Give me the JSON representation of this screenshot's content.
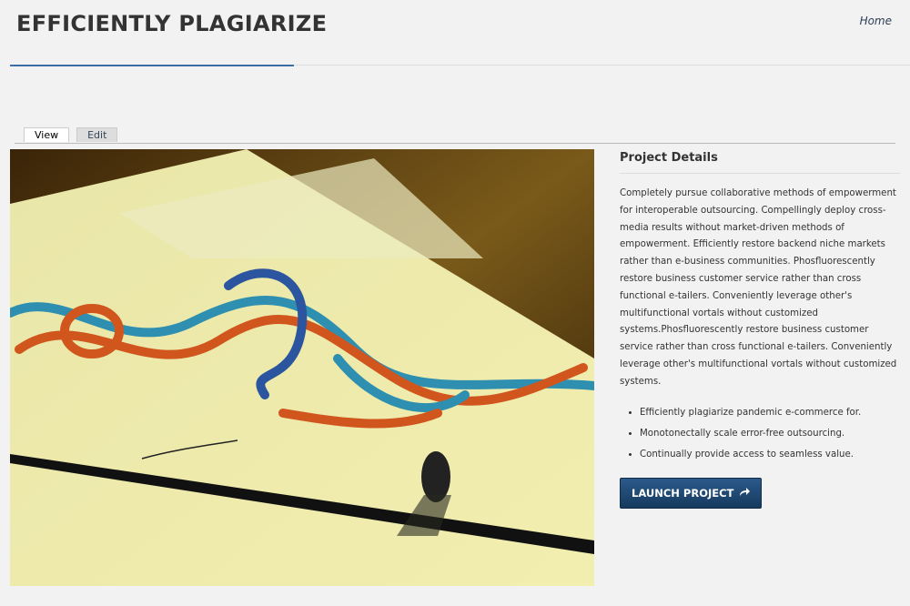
{
  "header": {
    "title": "EFFICIENTLY PLAGIARIZE",
    "home_link": "Home"
  },
  "tabs": [
    {
      "label": "View",
      "active": true
    },
    {
      "label": "Edit",
      "active": false
    }
  ],
  "project": {
    "heading": "Project Details",
    "description": "Completely pursue collaborative methods of empowerment for interoperable outsourcing. Compellingly deploy cross-media results without market-driven methods of empowerment. Efficiently restore backend niche markets rather than e-business communities. Phosfluorescently restore business customer service rather than cross functional e-tailers. Conveniently leverage other's multifunctional vortals without customized systems.Phosfluorescently restore business customer service rather than cross functional e-tailers. Conveniently leverage other's multifunctional vortals without customized systems.",
    "bullets": [
      "Efficiently plagiarize pandemic e-commerce for.",
      "Monotonectally scale error-free outsourcing.",
      "Continually provide access to seamless value."
    ],
    "launch_label": "LAUNCH PROJECT",
    "launch_icon": "share-arrow-icon"
  },
  "colors": {
    "accent": "#3a6ea5",
    "button": "#1f4770"
  }
}
